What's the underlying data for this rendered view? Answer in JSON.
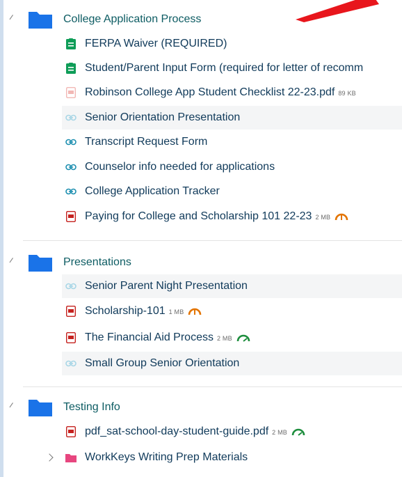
{
  "colors": {
    "folder_blue": "#1a73e8",
    "folder_pink": "#e7467f",
    "form_green": "#0f9d58",
    "pdf_red": "#c5221f",
    "pdf_faded": "#f2b8b5",
    "link_teal": "#1d8fb0",
    "link_faded": "#a8d6e6",
    "gauge_orange": "#e37400",
    "gauge_green": "#1e8e3e"
  },
  "sections": [
    {
      "title": "College Application Process",
      "items": [
        {
          "icon": "form-icon",
          "label": "FERPA Waiver (REQUIRED)"
        },
        {
          "icon": "form-icon",
          "label": "Student/Parent Input Form (required for letter of recomm"
        },
        {
          "icon": "pdf-icon-faded",
          "label": "Robinson College App Student Checklist 22-23.pdf",
          "size": "89 KB"
        },
        {
          "icon": "link-icon-faded",
          "label": "Senior Orientation Presentation"
        },
        {
          "icon": "link-icon",
          "label": "Transcript Request Form"
        },
        {
          "icon": "link-icon",
          "label": "Counselor info needed for applications"
        },
        {
          "icon": "link-icon",
          "label": "College Application Tracker"
        },
        {
          "icon": "pdf-icon",
          "label": "Paying for College and Scholarship 101 22-23",
          "size": "2 MB",
          "gauge": "orange-gauge-icon"
        }
      ]
    },
    {
      "title": "Presentations",
      "items": [
        {
          "icon": "link-icon-faded",
          "label": "Senior Parent Night Presentation"
        },
        {
          "icon": "pdf-icon",
          "label": "Scholarship-101",
          "size": "1 MB",
          "gauge": "orange-gauge-icon"
        },
        {
          "icon": "pdf-icon",
          "label": "The Financial Aid Process",
          "size": "2 MB",
          "gauge": "green-gauge-icon"
        },
        {
          "icon": "link-icon-faded",
          "label": "Small Group Senior Orientation"
        }
      ]
    },
    {
      "title": "Testing Info",
      "items": [
        {
          "icon": "pdf-icon",
          "label": "pdf_sat-school-day-student-guide.pdf",
          "size": "2 MB",
          "gauge": "green-gauge-icon"
        },
        {
          "icon": "folder-pink-icon",
          "label": "WorkKeys Writing Prep Materials"
        }
      ]
    }
  ]
}
